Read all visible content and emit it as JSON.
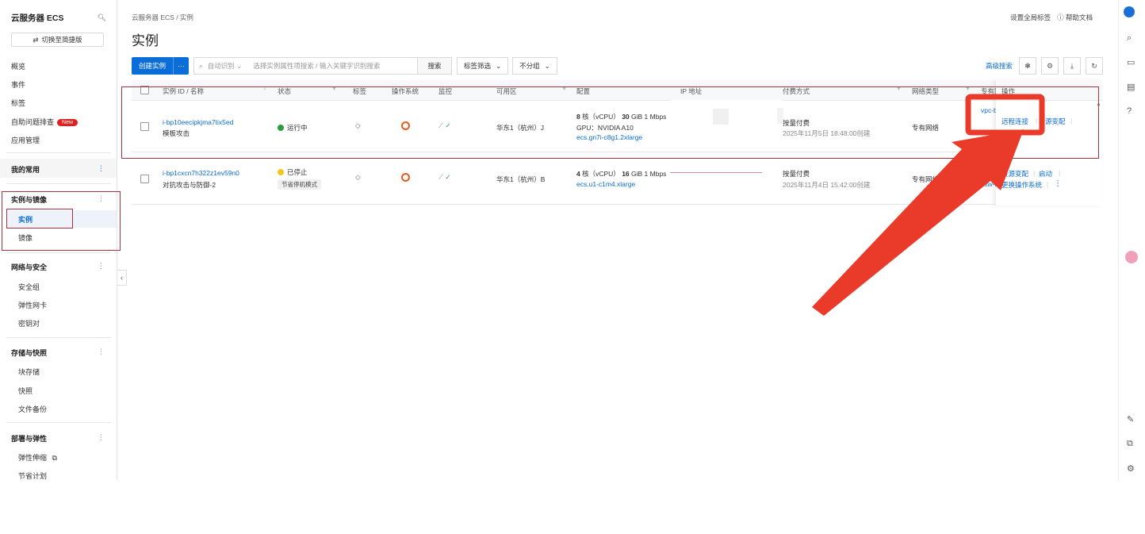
{
  "sidebar": {
    "title": "云服务器 ECS",
    "switch_label": "切换至简捷版",
    "top_items": [
      "概览",
      "事件",
      "标签",
      "自助问题排查",
      "应用管理"
    ],
    "new_badge": "New",
    "fav_group": "我的常用",
    "groups": [
      {
        "label": "实例与镜像",
        "items": [
          "实例",
          "镜像"
        ]
      },
      {
        "label": "网络与安全",
        "items": [
          "安全组",
          "弹性网卡",
          "密钥对"
        ]
      },
      {
        "label": "存储与快照",
        "items": [
          "块存储",
          "快照",
          "文件备份"
        ]
      },
      {
        "label": "部署与弹性",
        "items": [
          "弹性伸缩",
          "节省计划"
        ]
      }
    ]
  },
  "header": {
    "breadcrumb": "云服务器 ECS  /  实例",
    "title": "实例",
    "set_tags": "设置全局标签",
    "help": "帮助文档"
  },
  "toolbar": {
    "create_label": "创建实例",
    "more_label": "···",
    "search_mode": "自动识别",
    "search_placeholder": "选择实例属性项搜索 / 输入关键字识别搜索",
    "search_button": "搜索",
    "tag_filter": "标签筛选",
    "group": "不分组",
    "advanced_search": "高级搜索"
  },
  "table": {
    "columns": [
      "实例 ID / 名称",
      "状态",
      "标签",
      "操作系统",
      "监控",
      "可用区",
      "配置",
      "IP 地址",
      "付费方式",
      "网络类型",
      "专有网",
      "操作"
    ],
    "rows": [
      {
        "id": "i-bp10eecipkjma7tix5ed",
        "name": "模板攻击",
        "status": "运行中",
        "status_color": "#2a9d3a",
        "zone": "华东1（杭州）J",
        "config_cpu": "8",
        "config_cpu_text": "核（vCPU）",
        "config_mem": "30",
        "config_mem_text": "GiB 1 Mbps",
        "gpu": "GPU：NVIDIA A10",
        "spec": "ecs.gn7i-c8g1.2xlarge",
        "billing": "按量付费",
        "created": "2025年11月5日 18:48:00创建",
        "network": "专有网络",
        "vpc": "vpc-b",
        "actions": [
          "远程连接",
          "源变配"
        ]
      },
      {
        "id": "i-bp1cxcn7h322z1ev59n0",
        "name": "对抗攻击与防御-2",
        "status": "已停止",
        "status_color": "#f5c518",
        "status_tag": "节省停机模式",
        "zone": "华东1（杭州）B",
        "config_cpu": "4",
        "config_cpu_text": "核（vCPU）",
        "config_mem": "16",
        "config_mem_text": "GiB 1 Mbps",
        "spec": "ecs.u1-c1m4.xlarge",
        "billing": "按量付费",
        "created": "2025年11月4日 15:42:00创建",
        "network": "专有网络",
        "vpc": "vsw-b",
        "actions": [
          "资源变配",
          "启动",
          "更换操作系统"
        ]
      }
    ]
  }
}
